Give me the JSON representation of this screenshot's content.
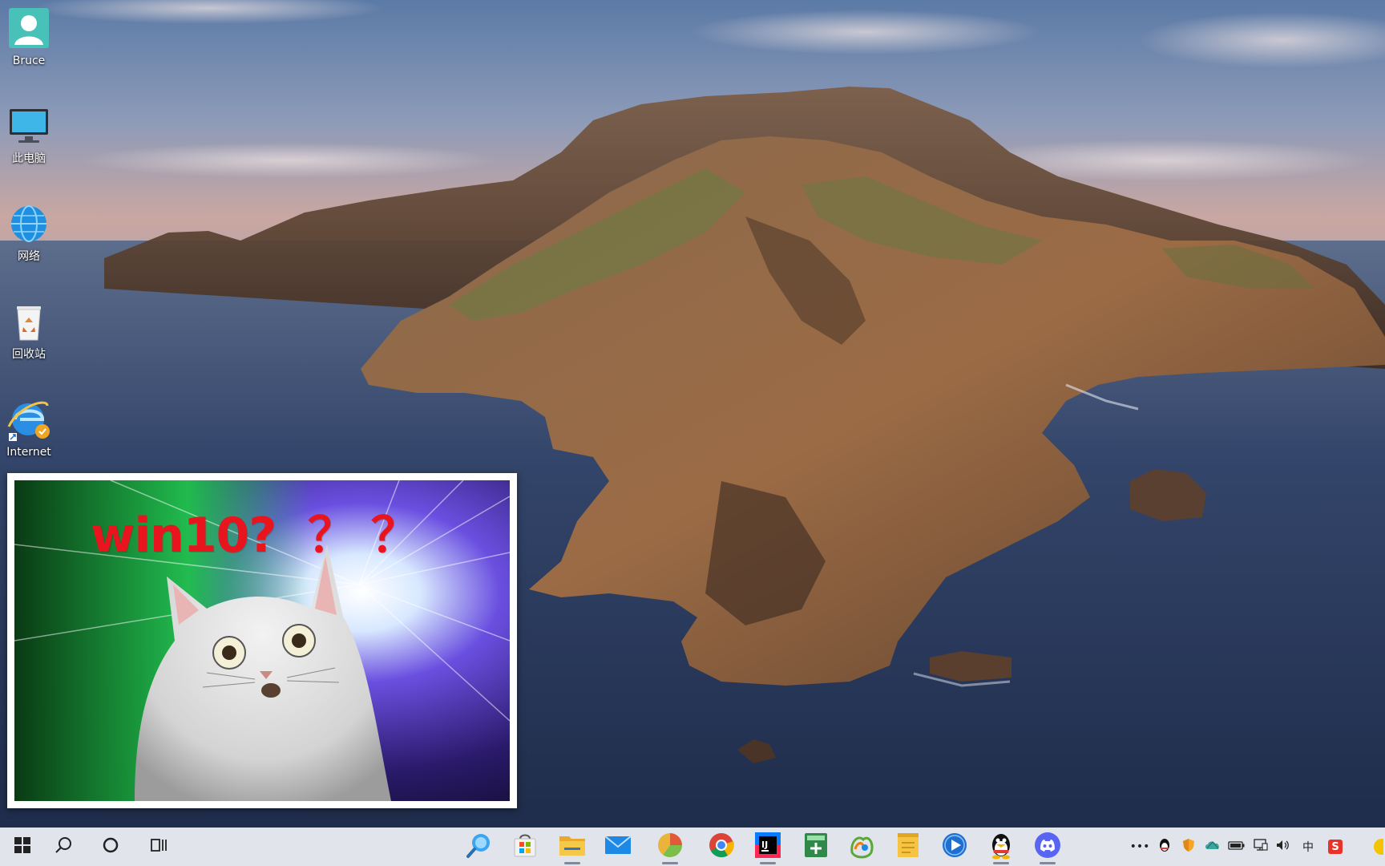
{
  "desktop": {
    "icons": [
      {
        "label": "Bruce",
        "icon": "user-folder-icon"
      },
      {
        "label": "此电脑",
        "icon": "this-pc-icon"
      },
      {
        "label": "网络",
        "icon": "network-icon"
      },
      {
        "label": "回收站",
        "icon": "recycle-bin-icon"
      },
      {
        "label": "Internet",
        "icon": "internet-explorer-icon"
      }
    ]
  },
  "meme": {
    "caption": "win10?  ？ ？"
  },
  "taskbar": {
    "system_buttons": [
      "start-icon",
      "search-icon",
      "cortana-icon",
      "task-view-icon"
    ],
    "pinned_apps": [
      "search-magnifier-app-icon",
      "microsoft-store-icon",
      "file-explorer-icon",
      "mail-icon",
      "chart-app-icon",
      "chrome-icon",
      "intellij-idea-icon",
      "calculator-plus-icon",
      "navicat-icon",
      "sticky-notes-icon",
      "media-player-icon",
      "qq-icon",
      "discord-icon"
    ],
    "tray": {
      "overflow": "•••",
      "icons": [
        "qq-tray-icon",
        "shield-tray-icon",
        "cloud-tray-icon",
        "battery-icon",
        "network-tray-icon",
        "volume-icon"
      ],
      "ime": "中",
      "sogou": "S"
    }
  },
  "colors": {
    "taskbar_bg": "#eef0f4",
    "caption_red": "#e8141e",
    "accent_blue": "#1e90ff"
  }
}
